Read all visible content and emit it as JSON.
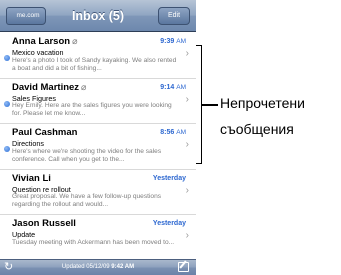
{
  "navbar": {
    "back_label": "me.com",
    "title": "Inbox (5)",
    "edit_label": "Edit"
  },
  "messages": [
    {
      "sender": "Anna Larson",
      "attachment": true,
      "time": "9:39",
      "ampm": "AM",
      "unread": true,
      "subject": "Mexico vacation",
      "preview": "Here's a photo I took of Sandy kayaking. We also rented a boat and did a bit of fishing..."
    },
    {
      "sender": "David Martinez",
      "attachment": true,
      "time": "9:14",
      "ampm": "AM",
      "unread": true,
      "subject": "Sales Figures",
      "preview": "Hey Emily. Here are the sales figures you were looking for. Please let me know..."
    },
    {
      "sender": "Paul Cashman",
      "attachment": false,
      "time": "8:56",
      "ampm": "AM",
      "unread": true,
      "subject": "Directions",
      "preview": "Here's where we're shooting the video for the sales conference. Call when you get to the..."
    },
    {
      "sender": "Vivian Li",
      "attachment": false,
      "time": "Yesterday",
      "ampm": "",
      "unread": false,
      "subject": "Question re rollout",
      "preview": "Great proposal. We have a few follow-up questions regarding the rollout and would..."
    },
    {
      "sender": "Jason Russell",
      "attachment": false,
      "time": "Yesterday",
      "ampm": "",
      "unread": false,
      "subject": "Update",
      "preview": "Tuesday meeting with Ackermann has been moved to..."
    }
  ],
  "toolbar": {
    "updated_prefix": "Updated",
    "updated_date": "05/12/09",
    "updated_time": "9:42 AM"
  },
  "annotation": {
    "line1": "Непрочетени",
    "line2": "съобщения"
  },
  "colors": {
    "unread_dot": "#2d6fd6",
    "time_text": "#2c67d0",
    "navbar": "#7f97b8"
  }
}
